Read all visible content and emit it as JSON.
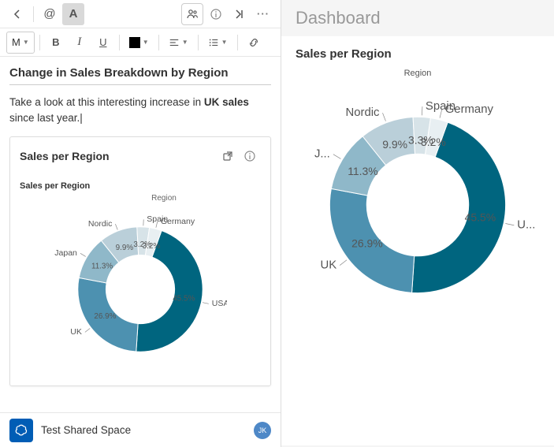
{
  "toolbar1": {
    "back": "‹",
    "mention": "@",
    "text_mode": "A",
    "people": "people",
    "info": "i",
    "goto": ">|",
    "more": "···"
  },
  "toolbar2": {
    "para_style": "M",
    "bold": "B",
    "italic": "I",
    "underline": "U",
    "color": "#000000"
  },
  "editor": {
    "heading": "Change in Sales Breakdown by Region",
    "para_pre": "Take a look at this interesting increase in ",
    "para_bold": "UK sales",
    "para_post": " since last year.",
    "cursor": "|"
  },
  "card": {
    "title": "Sales per Region",
    "subtitle": "Sales per Region",
    "legend": "Region"
  },
  "dashboard": {
    "title": "Dashboard",
    "chart_title": "Sales per Region",
    "legend": "Region"
  },
  "footer": {
    "space": "Test Shared Space",
    "initials": "JK"
  },
  "chart_data": {
    "type": "pie",
    "title": "Sales per Region",
    "legend_title": "Region",
    "slices": [
      {
        "label": "USA",
        "short": "U...",
        "value": 45.5,
        "color": "#00657f"
      },
      {
        "label": "UK",
        "short": "UK",
        "value": 26.9,
        "color": "#4d91b0"
      },
      {
        "label": "Japan",
        "short": "J...",
        "value": 11.3,
        "color": "#8fb8c9"
      },
      {
        "label": "Nordic",
        "short": "Nordic",
        "value": 9.9,
        "color": "#bacfd9"
      },
      {
        "label": "Spain",
        "short": "Spain",
        "value": 3.2,
        "color": "#d7e3e8"
      },
      {
        "label": "Germany",
        "short": "Germany",
        "value": 3.2,
        "color": "#e8eff2"
      }
    ],
    "display_big_other": "3.3%"
  }
}
